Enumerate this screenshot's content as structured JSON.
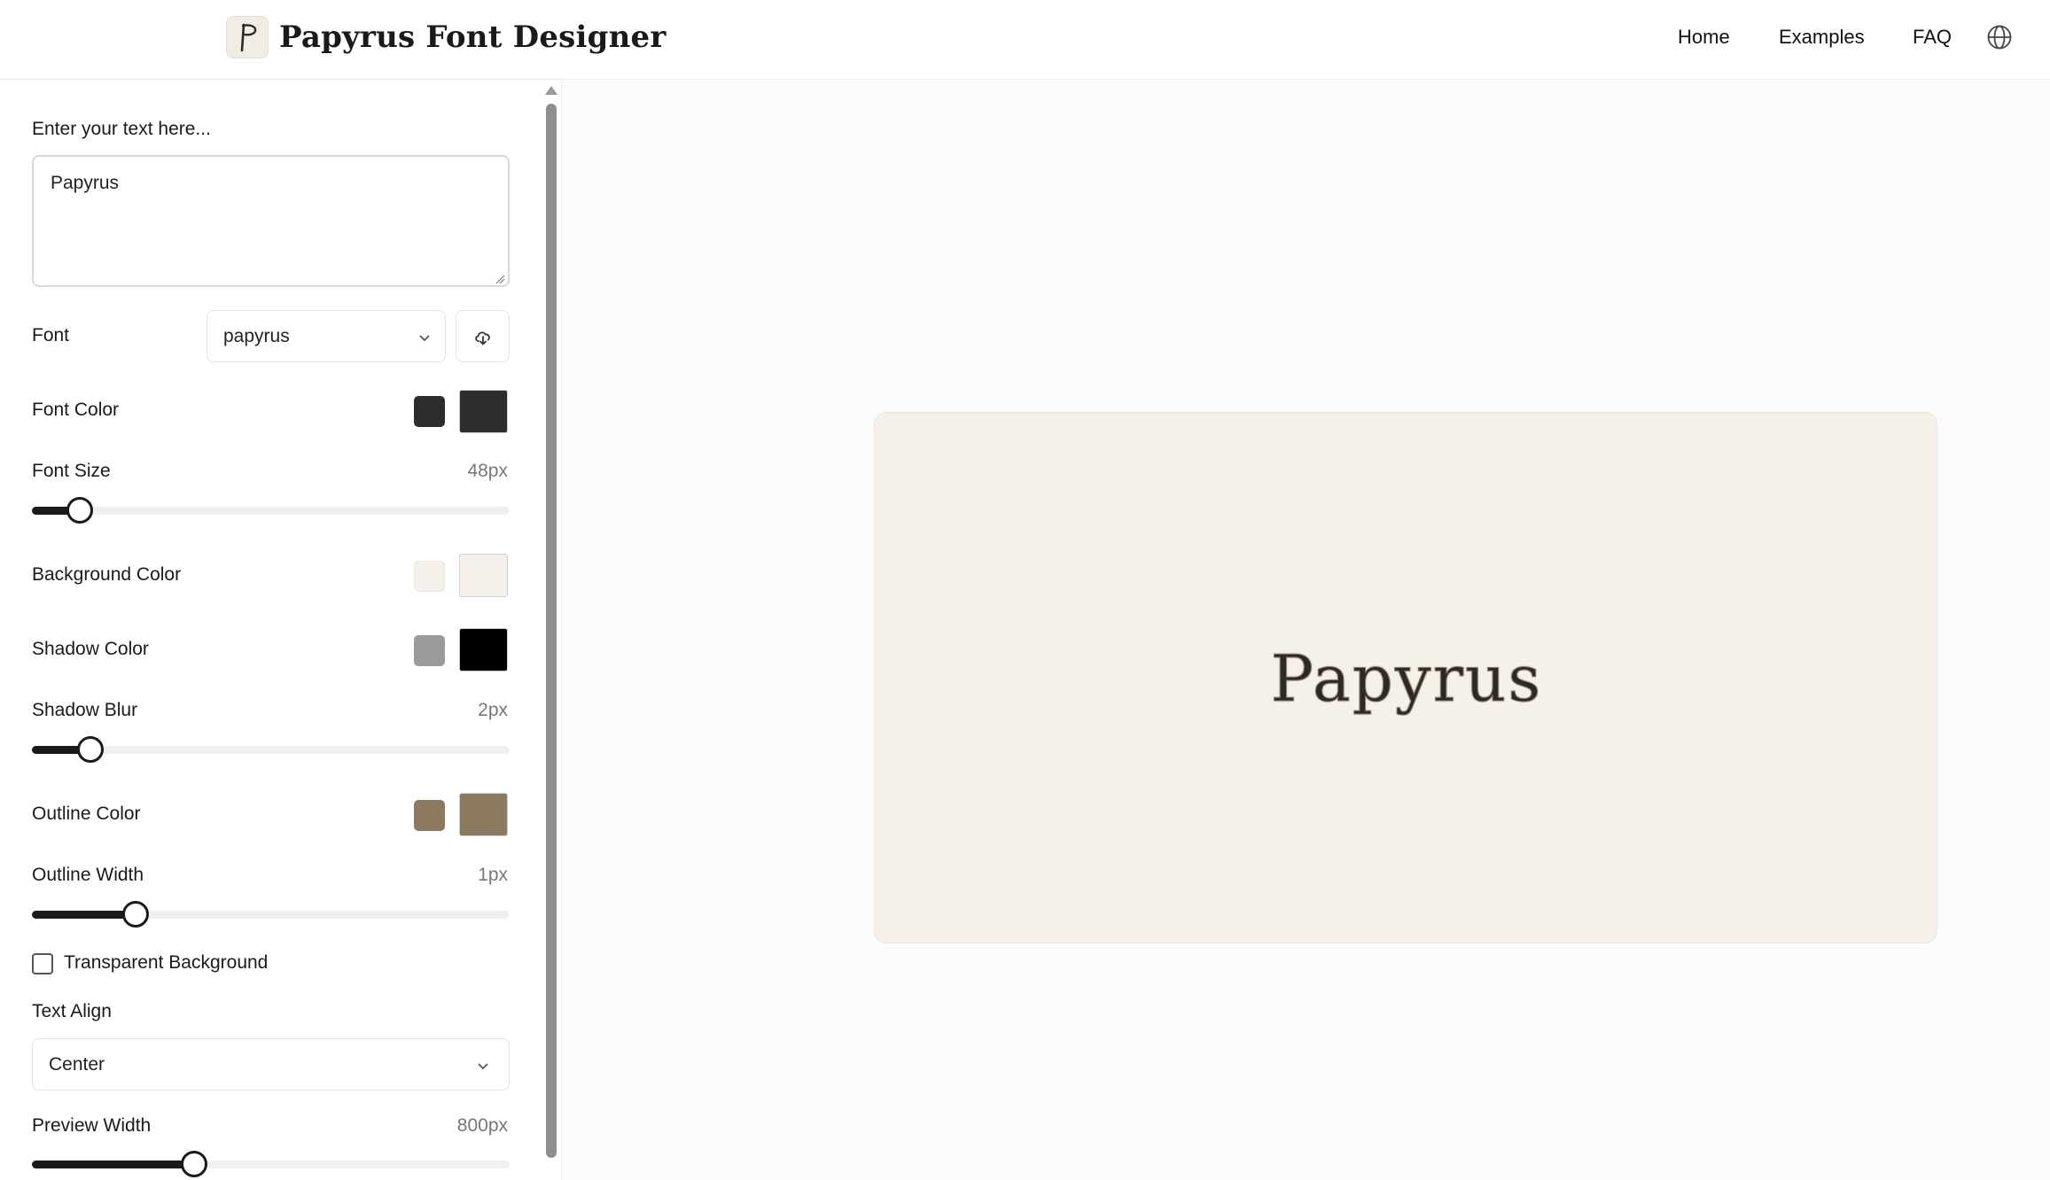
{
  "header": {
    "brand": "Papyrus Font Designer",
    "logo_icon": "papyrus-p-logo-icon",
    "nav": [
      {
        "label": "Home"
      },
      {
        "label": "Examples"
      },
      {
        "label": "FAQ"
      }
    ],
    "language_icon": "globe-icon"
  },
  "sidebar": {
    "text_label": "Enter your text here...",
    "text_value": "Papyrus",
    "font_label": "Font",
    "font_value": "papyrus",
    "download_icon": "cloud-download-icon",
    "font_color_label": "Font Color",
    "font_color": "#2d2d2d",
    "font_size_label": "Font Size",
    "font_size_value": "48px",
    "font_size_slider": 0.1,
    "bg_color_label": "Background Color",
    "bg_color": "#f5f1ea",
    "shadow_color_label": "Shadow Color",
    "shadow_color_small": "#9a9a9a",
    "shadow_color": "#000000",
    "shadow_blur_label": "Shadow Blur",
    "shadow_blur_value": "2px",
    "shadow_blur_slider": 0.12,
    "outline_color_label": "Outline Color",
    "outline_color": "#8b7a60",
    "outline_width_label": "Outline Width",
    "outline_width_value": "1px",
    "outline_width_slider": 0.22,
    "transparent_label": "Transparent Background",
    "transparent_checked": false,
    "text_align_label": "Text Align",
    "text_align_value": "Center",
    "preview_width_label": "Preview Width",
    "preview_width_value": "800px",
    "preview_width_slider": 0.34
  },
  "preview": {
    "text": "Papyrus"
  }
}
